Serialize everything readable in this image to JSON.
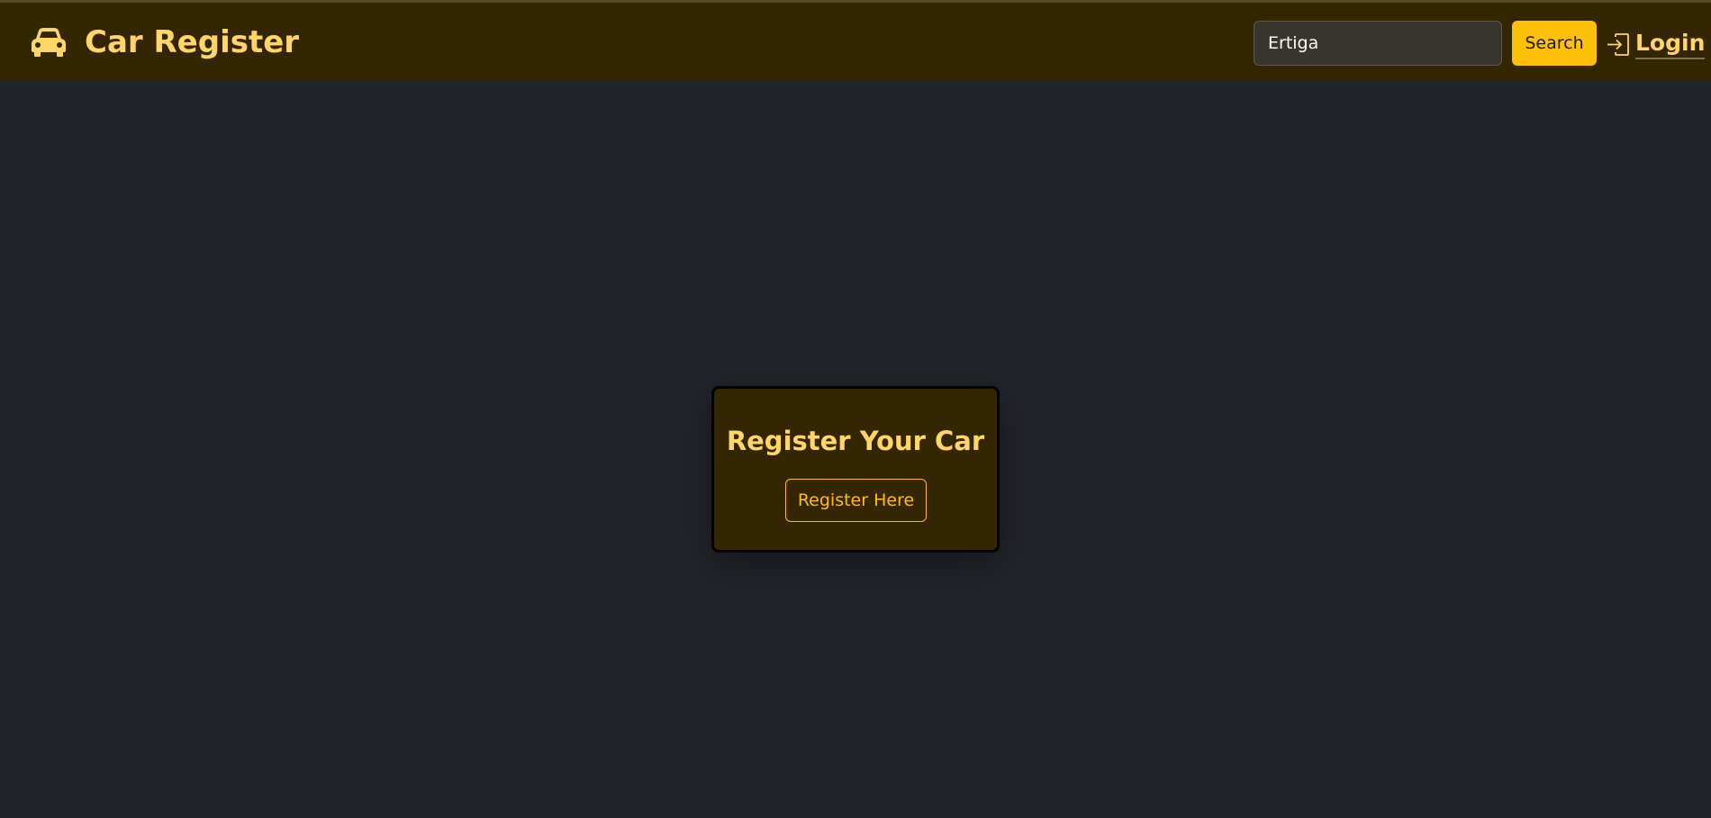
{
  "navbar": {
    "brand": {
      "icon": "car-icon",
      "text": "Car Register"
    },
    "search": {
      "value": "Ertiga",
      "button_label": "Search"
    },
    "login": {
      "icon": "login-icon",
      "label": "Login"
    }
  },
  "main": {
    "card": {
      "title": "Register Your Car",
      "button_label": "Register Here"
    }
  },
  "colors": {
    "page_background": "#212429",
    "navbar_background": "#332600",
    "accent": "#ffc107",
    "heading": "#ffd667"
  }
}
